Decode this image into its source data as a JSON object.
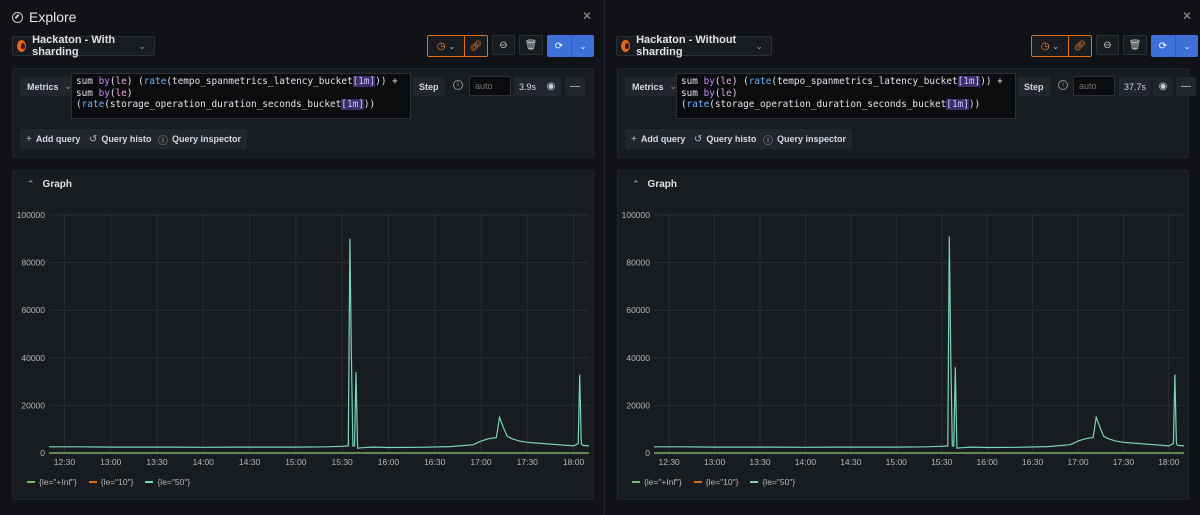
{
  "window": {
    "title": "Explore"
  },
  "colors": {
    "series_inf": "#73bf69",
    "series_10": "#e36e12",
    "series_50": "#7bd3bf",
    "run_button": "#3d71d9",
    "accent_border": "#e36e12"
  },
  "icons": {
    "explore": "compass-icon",
    "close": "close-icon",
    "datasource": "prometheus-flame-icon",
    "history": "clock-icon",
    "link": "link-icon",
    "zoom_out": "zoom-out-icon",
    "clear": "trash-icon",
    "run": "refresh-icon"
  },
  "panes": [
    {
      "datasource": "Hackaton - With sharding",
      "query_type": "Metrics",
      "step_label": "Step",
      "step_placeholder": "auto",
      "step_value": "3.9s",
      "add_query": "Add query",
      "query_history": "Query history",
      "query_inspector": "Query inspector",
      "graph_title": "Graph",
      "legend": [
        "{le=\"+Inf\"}",
        "{le=\"10\"}",
        "{le=\"50\"}"
      ],
      "chart_data": {
        "type": "line",
        "title": "",
        "y_ticks": [
          "0",
          "20000",
          "40000",
          "60000",
          "80000",
          "100000"
        ],
        "x_ticks": [
          "12:30",
          "13:00",
          "13:30",
          "14:00",
          "14:30",
          "15:00",
          "15:30",
          "16:00",
          "16:30",
          "17:00",
          "17:30",
          "18:00"
        ],
        "ylim": [
          0,
          100000
        ],
        "xlim": [
          "12:20",
          "18:10"
        ],
        "grid": true,
        "legend_position": "bottom-left",
        "series": [
          {
            "name": "{le=\"50\"}",
            "x": [
              "12:20",
              "12:40",
              "13:00",
              "13:20",
              "13:40",
              "14:00",
              "14:20",
              "14:40",
              "15:00",
              "15:20",
              "15:30",
              "15:34",
              "15:35",
              "15:36",
              "15:37",
              "15:38",
              "15:39",
              "15:40",
              "15:42",
              "15:50",
              "16:00",
              "16:20",
              "16:40",
              "16:55",
              "17:00",
              "17:05",
              "17:10",
              "17:12",
              "17:15",
              "17:17",
              "17:20",
              "17:25",
              "17:30",
              "17:40",
              "17:50",
              "18:00",
              "18:03",
              "18:04",
              "18:05",
              "18:06",
              "18:10"
            ],
            "y": [
              2600,
              2600,
              2500,
              2500,
              2500,
              2400,
              2500,
              2500,
              2500,
              2600,
              2800,
              3000,
              90000,
              40000,
              3000,
              3000,
              34000,
              2000,
              2200,
              2500,
              2300,
              2400,
              2700,
              3500,
              5000,
              6000,
              6500,
              15000,
              10000,
              7000,
              6000,
              5000,
              4500,
              4000,
              3500,
              3000,
              4000,
              33000,
              4000,
              3200,
              3000
            ]
          },
          {
            "name": "{le=\"10\"}",
            "x": [
              "12:20",
              "18:10"
            ],
            "y": [
              0,
              0
            ]
          },
          {
            "name": "{le=\"+Inf\"}",
            "x": [
              "12:20",
              "18:10"
            ],
            "y": [
              0,
              0
            ]
          }
        ]
      }
    },
    {
      "datasource": "Hackaton - Without sharding",
      "query_type": "Metrics",
      "step_label": "Step",
      "step_placeholder": "auto",
      "step_value": "37.7s",
      "add_query": "Add query",
      "query_history": "Query history",
      "query_inspector": "Query inspector",
      "graph_title": "Graph",
      "legend": [
        "{le=\"+Inf\"}",
        "{le=\"10\"}",
        "{le=\"50\"}"
      ],
      "chart_data": {
        "type": "line",
        "title": "",
        "y_ticks": [
          "0",
          "20000",
          "40000",
          "60000",
          "80000",
          "100000"
        ],
        "x_ticks": [
          "12:30",
          "13:00",
          "13:30",
          "14:00",
          "14:30",
          "15:00",
          "15:30",
          "16:00",
          "16:30",
          "17:00",
          "17:30",
          "18:00"
        ],
        "ylim": [
          0,
          100000
        ],
        "xlim": [
          "12:20",
          "18:10"
        ],
        "grid": true,
        "legend_position": "bottom-left",
        "series": [
          {
            "name": "{le=\"50\"}",
            "x": [
              "12:20",
              "12:40",
              "13:00",
              "13:20",
              "13:40",
              "14:00",
              "14:20",
              "14:40",
              "15:00",
              "15:20",
              "15:30",
              "15:34",
              "15:35",
              "15:36",
              "15:37",
              "15:38",
              "15:39",
              "15:40",
              "15:42",
              "15:50",
              "16:00",
              "16:20",
              "16:40",
              "16:55",
              "17:00",
              "17:05",
              "17:10",
              "17:12",
              "17:15",
              "17:17",
              "17:20",
              "17:25",
              "17:30",
              "17:40",
              "17:50",
              "18:00",
              "18:03",
              "18:04",
              "18:05",
              "18:06",
              "18:10"
            ],
            "y": [
              2600,
              2600,
              2500,
              2500,
              2500,
              2400,
              2500,
              2500,
              2500,
              2600,
              2800,
              3000,
              91000,
              40000,
              3000,
              3000,
              36000,
              2000,
              2200,
              2500,
              2300,
              2400,
              2700,
              3500,
              5000,
              6000,
              6500,
              15000,
              10000,
              7000,
              6000,
              5000,
              4500,
              4000,
              3500,
              3000,
              4000,
              33000,
              4000,
              3200,
              3000
            ]
          },
          {
            "name": "{le=\"10\"}",
            "x": [
              "12:20",
              "18:10"
            ],
            "y": [
              0,
              0
            ]
          },
          {
            "name": "{le=\"+Inf\"}",
            "x": [
              "12:20",
              "18:10"
            ],
            "y": [
              0,
              0
            ]
          }
        ]
      }
    }
  ],
  "query": {
    "p1": "sum ",
    "p2": "by",
    "p3": "(",
    "p4": "le",
    "p5": ") (",
    "p6": "rate",
    "p7": "(tempo_spanmetrics_latency_bucket",
    "p8": "[1m]",
    "p9": ")) +",
    "p10": "sum ",
    "p11": "by",
    "p12": "(",
    "p13": "le",
    "p14": ")",
    "p15": "(",
    "p16": "rate",
    "p17": "(storage_operation_duration_seconds_bucket",
    "p18": "[1m]",
    "p19": "))"
  }
}
